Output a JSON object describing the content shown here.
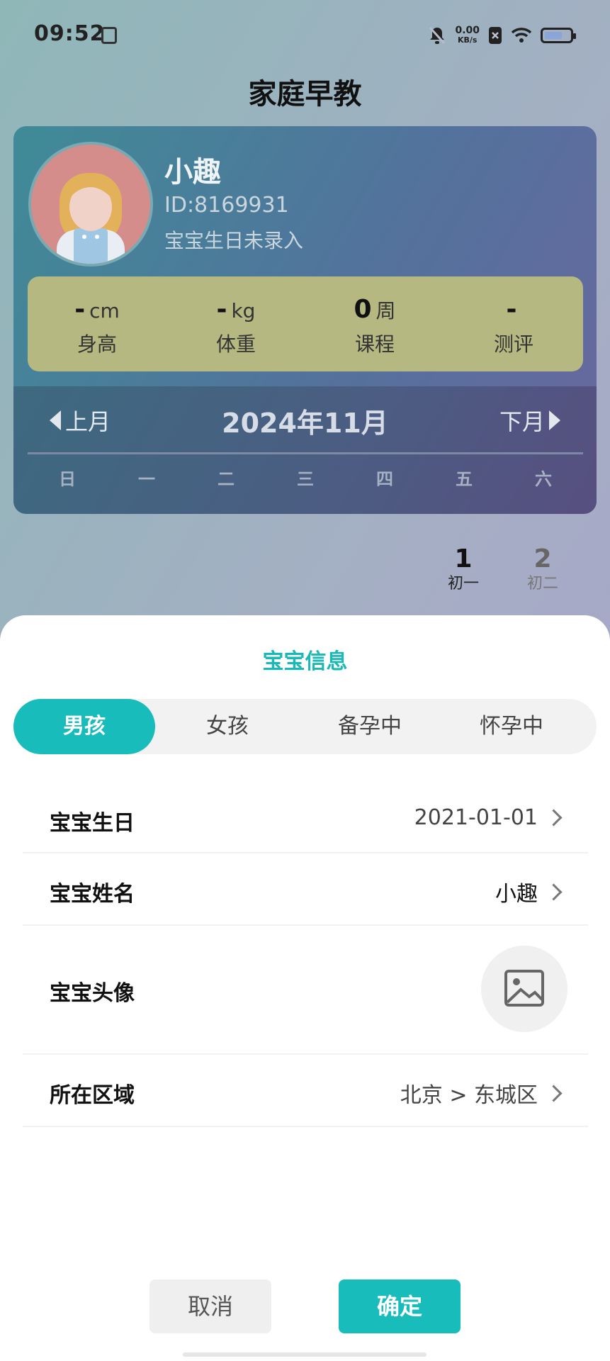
{
  "status_bar": {
    "time": "09:52",
    "net_speed": "0.00",
    "net_unit": "KB/s"
  },
  "page_title": "家庭早教",
  "profile": {
    "name": "小趣",
    "id_text": "ID:8169931",
    "birth_status": "宝宝生日未录入"
  },
  "stats": [
    {
      "value": "-",
      "unit": "cm",
      "label": "身高"
    },
    {
      "value": "-",
      "unit": "kg",
      "label": "体重"
    },
    {
      "value": "0",
      "unit": "周",
      "label": "课程"
    },
    {
      "value": "-",
      "unit": "",
      "label": "测评"
    }
  ],
  "calendar": {
    "prev_label": "上月",
    "month_title": "2024年11月",
    "next_label": "下月",
    "weekdays": [
      "日",
      "一",
      "二",
      "三",
      "四",
      "五",
      "六"
    ],
    "days": [
      {
        "num": "1",
        "lunar": "初一"
      },
      {
        "num": "2",
        "lunar": "初二"
      }
    ]
  },
  "sheet": {
    "title": "宝宝信息",
    "gender_options": [
      "男孩",
      "女孩",
      "备孕中",
      "怀孕中"
    ],
    "selected_gender": "男孩",
    "rows": {
      "birthday": {
        "label": "宝宝生日",
        "value": "2021-01-01"
      },
      "name": {
        "label": "宝宝姓名",
        "value": "小趣"
      },
      "avatar": {
        "label": "宝宝头像"
      },
      "region": {
        "label": "所在区域",
        "value": "北京 > 东城区"
      }
    },
    "cancel_label": "取消",
    "confirm_label": "确定"
  },
  "colors": {
    "accent": "#17bcbb",
    "stats_bg": "#b6b881",
    "avatar_bg": "#d48d8b"
  },
  "icons": {
    "avatar_placeholder": "image-icon",
    "row_arrow": "chevron-right-icon"
  }
}
